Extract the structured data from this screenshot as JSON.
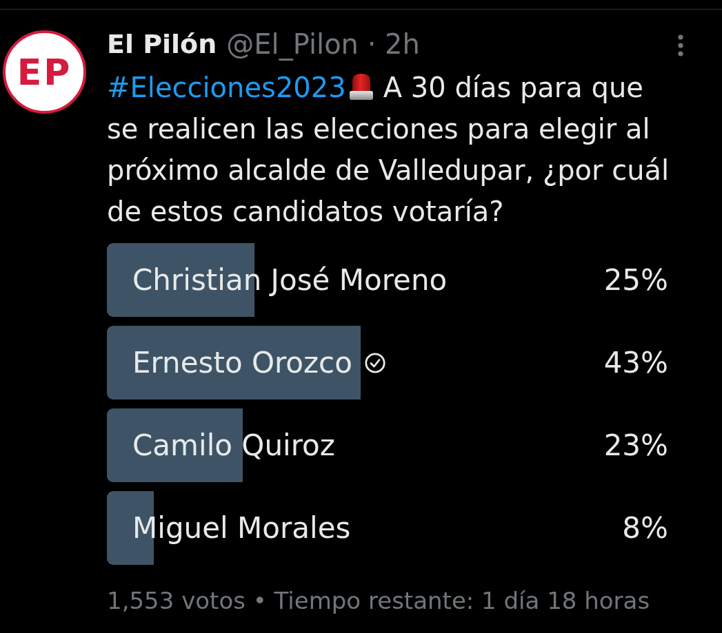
{
  "tweet": {
    "avatar": {
      "text": "EP"
    },
    "author": {
      "name": "El Pilón",
      "meta": "@El_Pilon · 2h"
    },
    "text": {
      "hashtag": "#Elecciones2023",
      "body": "A 30 días para que se realicen las elecciones para elegir al próximo alcalde de Valledupar, ¿por cuál de estos candidatos votaría?"
    },
    "poll": {
      "options": [
        {
          "label": "Christian José Moreno",
          "percent": "25%",
          "level": 0.25,
          "selected": false
        },
        {
          "label": "Ernesto Orozco",
          "percent": "43%",
          "level": 0.43,
          "selected": true
        },
        {
          "label": "Camilo Quiroz",
          "percent": "23%",
          "level": 0.23,
          "selected": false
        },
        {
          "label": "Miguel Morales",
          "percent": "8%",
          "level": 0.08,
          "selected": false
        }
      ],
      "footer": "1,553 votos • Tiempo restante: 1 día 18 horas"
    }
  }
}
